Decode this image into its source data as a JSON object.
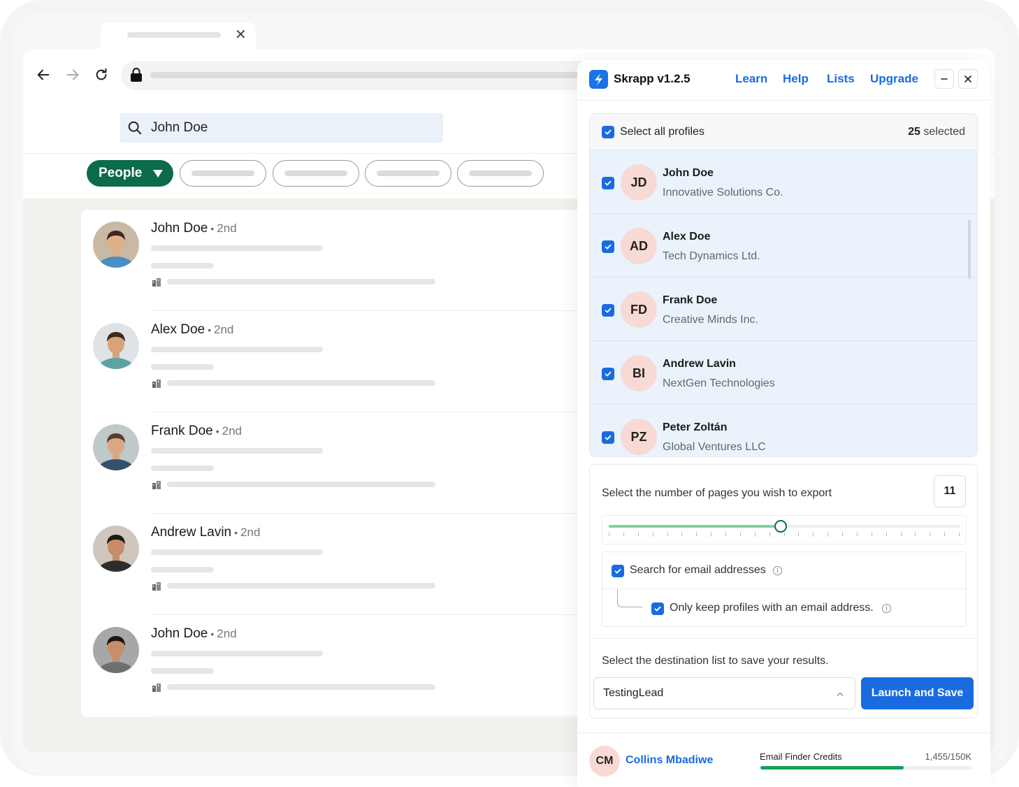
{
  "browser": {
    "search": {
      "value": "John Doe"
    },
    "filter": {
      "people_label": "People"
    }
  },
  "results": [
    {
      "name": "John Doe",
      "degree": "2nd",
      "photo": "man-short-hair-glasses"
    },
    {
      "name": "Alex Doe",
      "degree": "2nd",
      "photo": "man-curly-hair-glasses"
    },
    {
      "name": "Frank Doe",
      "degree": "2nd",
      "photo": "man-beard-floral-shirt"
    },
    {
      "name": "Andrew Lavin",
      "degree": "2nd",
      "photo": "man-smiling"
    },
    {
      "name": "John Doe",
      "degree": "2nd",
      "photo": "man-smiling-dark-hair"
    }
  ],
  "panel": {
    "title": "Skrapp v1.2.5",
    "links": {
      "learn": "Learn",
      "help": "Help",
      "lists": "Lists",
      "upgrade": "Upgrade"
    },
    "select_all_label": "Select all profiles",
    "selected_count": "25",
    "selected_suffix": "selected",
    "profiles": [
      {
        "initials": "JD",
        "name": "John Doe",
        "company": "Innovative Solutions Co."
      },
      {
        "initials": "AD",
        "name": "Alex Doe",
        "company": "Tech Dynamics Ltd."
      },
      {
        "initials": "FD",
        "name": "Frank Doe",
        "company": "Creative Minds Inc."
      },
      {
        "initials": "BI",
        "name": "Andrew Lavin",
        "company": "NextGen Technologies"
      },
      {
        "initials": "PZ",
        "name": "Peter Zoltán",
        "company": "Global Ventures LLC"
      }
    ],
    "pages_label": "Select the number of pages you wish to export",
    "pages_value": "11",
    "slider": {
      "fraction": 0.49,
      "tick_count": 25
    },
    "email_search_label": "Search for email addresses",
    "only_email_label": "Only keep profiles with an email address.",
    "destination_label": "Select the destination list to save your results.",
    "destination_value": "TestingLead",
    "launch_label": "Launch and Save",
    "user": {
      "initials": "CM",
      "name": "Collins Mbadiwe"
    },
    "credits": {
      "label": "Email Finder Credits",
      "value": "1,455/150K",
      "fraction": 0.68
    }
  },
  "colors": {
    "brand_blue": "#1a6be0",
    "people_green": "#0b6b4a",
    "slider_green": "#7fd39b",
    "credits_green": "#16a05a",
    "row_highlight": "#eaf3fc",
    "initials_bg": "#f9d9d4"
  }
}
